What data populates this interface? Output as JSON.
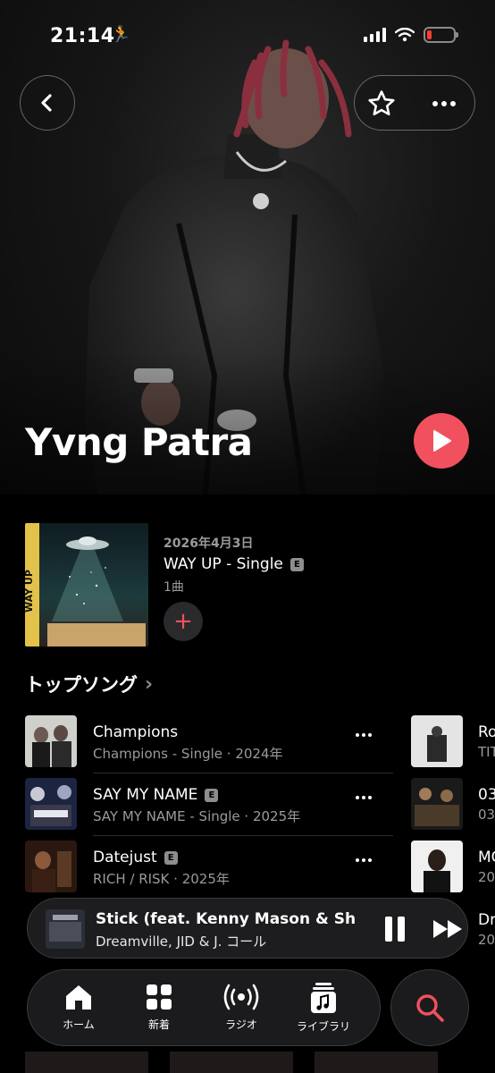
{
  "status": {
    "time": "21:14",
    "runner": "🏃",
    "battery_color": "#ff3b30"
  },
  "artist": {
    "name": "Yvng Patra"
  },
  "colors": {
    "accent": "#f1505e",
    "background": "#000000",
    "secondary_text": "#9a9a9a"
  },
  "icons": {
    "back": "chevron-left-icon",
    "favorite": "star-icon",
    "more": "ellipsis-icon",
    "play": "play-icon",
    "add": "plus-icon",
    "search": "search-icon"
  },
  "latest_release": {
    "date": "2026年4月3日",
    "title": "WAY UP - Single",
    "explicit": "E",
    "count": "1曲",
    "add_label": "+"
  },
  "top_songs": {
    "title": "トップソング",
    "chevron": "›",
    "items": [
      {
        "title": "Champions",
        "explicit": "",
        "subtitle": "Champions - Single · 2024年"
      },
      {
        "title": "SAY MY NAME",
        "explicit": "E",
        "subtitle": "SAY MY NAME - Single · 2025年"
      },
      {
        "title": "Datejust",
        "explicit": "E",
        "subtitle": "RICH / RISK · 2025年"
      }
    ],
    "second_column": [
      {
        "title": "Ro",
        "subtitle": "TIT"
      },
      {
        "title": "03",
        "subtitle": "03"
      },
      {
        "title": "MC",
        "subtitle": "20"
      },
      {
        "title": "Dr",
        "subtitle": "20"
      }
    ]
  },
  "now_playing": {
    "title": "Stick (feat. Kenny Mason & Sh",
    "artist": "Dreamville, JID & J. コール"
  },
  "tabs": [
    {
      "label": "ホーム",
      "icon": "home-icon"
    },
    {
      "label": "新着",
      "icon": "grid-icon"
    },
    {
      "label": "ラジオ",
      "icon": "radio-icon"
    },
    {
      "label": "ライブラリ",
      "icon": "library-icon"
    }
  ]
}
